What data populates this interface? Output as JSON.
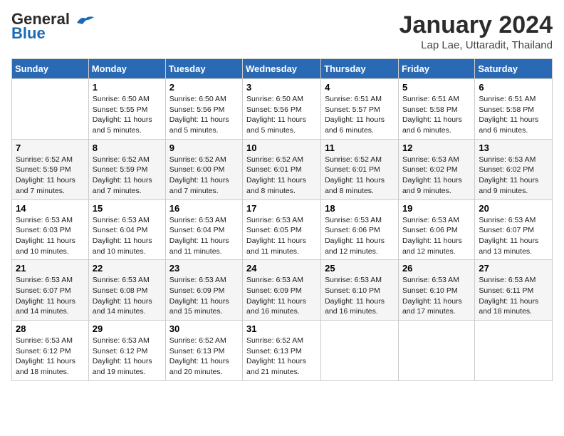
{
  "header": {
    "logo_line1": "General",
    "logo_line2": "Blue",
    "month": "January 2024",
    "location": "Lap Lae, Uttaradit, Thailand"
  },
  "days_of_week": [
    "Sunday",
    "Monday",
    "Tuesday",
    "Wednesday",
    "Thursday",
    "Friday",
    "Saturday"
  ],
  "weeks": [
    [
      {
        "day": "",
        "info": ""
      },
      {
        "day": "1",
        "info": "Sunrise: 6:50 AM\nSunset: 5:55 PM\nDaylight: 11 hours\nand 5 minutes."
      },
      {
        "day": "2",
        "info": "Sunrise: 6:50 AM\nSunset: 5:56 PM\nDaylight: 11 hours\nand 5 minutes."
      },
      {
        "day": "3",
        "info": "Sunrise: 6:50 AM\nSunset: 5:56 PM\nDaylight: 11 hours\nand 5 minutes."
      },
      {
        "day": "4",
        "info": "Sunrise: 6:51 AM\nSunset: 5:57 PM\nDaylight: 11 hours\nand 6 minutes."
      },
      {
        "day": "5",
        "info": "Sunrise: 6:51 AM\nSunset: 5:58 PM\nDaylight: 11 hours\nand 6 minutes."
      },
      {
        "day": "6",
        "info": "Sunrise: 6:51 AM\nSunset: 5:58 PM\nDaylight: 11 hours\nand 6 minutes."
      }
    ],
    [
      {
        "day": "7",
        "info": "Sunrise: 6:52 AM\nSunset: 5:59 PM\nDaylight: 11 hours\nand 7 minutes."
      },
      {
        "day": "8",
        "info": "Sunrise: 6:52 AM\nSunset: 5:59 PM\nDaylight: 11 hours\nand 7 minutes."
      },
      {
        "day": "9",
        "info": "Sunrise: 6:52 AM\nSunset: 6:00 PM\nDaylight: 11 hours\nand 7 minutes."
      },
      {
        "day": "10",
        "info": "Sunrise: 6:52 AM\nSunset: 6:01 PM\nDaylight: 11 hours\nand 8 minutes."
      },
      {
        "day": "11",
        "info": "Sunrise: 6:52 AM\nSunset: 6:01 PM\nDaylight: 11 hours\nand 8 minutes."
      },
      {
        "day": "12",
        "info": "Sunrise: 6:53 AM\nSunset: 6:02 PM\nDaylight: 11 hours\nand 9 minutes."
      },
      {
        "day": "13",
        "info": "Sunrise: 6:53 AM\nSunset: 6:02 PM\nDaylight: 11 hours\nand 9 minutes."
      }
    ],
    [
      {
        "day": "14",
        "info": "Sunrise: 6:53 AM\nSunset: 6:03 PM\nDaylight: 11 hours\nand 10 minutes."
      },
      {
        "day": "15",
        "info": "Sunrise: 6:53 AM\nSunset: 6:04 PM\nDaylight: 11 hours\nand 10 minutes."
      },
      {
        "day": "16",
        "info": "Sunrise: 6:53 AM\nSunset: 6:04 PM\nDaylight: 11 hours\nand 11 minutes."
      },
      {
        "day": "17",
        "info": "Sunrise: 6:53 AM\nSunset: 6:05 PM\nDaylight: 11 hours\nand 11 minutes."
      },
      {
        "day": "18",
        "info": "Sunrise: 6:53 AM\nSunset: 6:06 PM\nDaylight: 11 hours\nand 12 minutes."
      },
      {
        "day": "19",
        "info": "Sunrise: 6:53 AM\nSunset: 6:06 PM\nDaylight: 11 hours\nand 12 minutes."
      },
      {
        "day": "20",
        "info": "Sunrise: 6:53 AM\nSunset: 6:07 PM\nDaylight: 11 hours\nand 13 minutes."
      }
    ],
    [
      {
        "day": "21",
        "info": "Sunrise: 6:53 AM\nSunset: 6:07 PM\nDaylight: 11 hours\nand 14 minutes."
      },
      {
        "day": "22",
        "info": "Sunrise: 6:53 AM\nSunset: 6:08 PM\nDaylight: 11 hours\nand 14 minutes."
      },
      {
        "day": "23",
        "info": "Sunrise: 6:53 AM\nSunset: 6:09 PM\nDaylight: 11 hours\nand 15 minutes."
      },
      {
        "day": "24",
        "info": "Sunrise: 6:53 AM\nSunset: 6:09 PM\nDaylight: 11 hours\nand 16 minutes."
      },
      {
        "day": "25",
        "info": "Sunrise: 6:53 AM\nSunset: 6:10 PM\nDaylight: 11 hours\nand 16 minutes."
      },
      {
        "day": "26",
        "info": "Sunrise: 6:53 AM\nSunset: 6:10 PM\nDaylight: 11 hours\nand 17 minutes."
      },
      {
        "day": "27",
        "info": "Sunrise: 6:53 AM\nSunset: 6:11 PM\nDaylight: 11 hours\nand 18 minutes."
      }
    ],
    [
      {
        "day": "28",
        "info": "Sunrise: 6:53 AM\nSunset: 6:12 PM\nDaylight: 11 hours\nand 18 minutes."
      },
      {
        "day": "29",
        "info": "Sunrise: 6:53 AM\nSunset: 6:12 PM\nDaylight: 11 hours\nand 19 minutes."
      },
      {
        "day": "30",
        "info": "Sunrise: 6:52 AM\nSunset: 6:13 PM\nDaylight: 11 hours\nand 20 minutes."
      },
      {
        "day": "31",
        "info": "Sunrise: 6:52 AM\nSunset: 6:13 PM\nDaylight: 11 hours\nand 21 minutes."
      },
      {
        "day": "",
        "info": ""
      },
      {
        "day": "",
        "info": ""
      },
      {
        "day": "",
        "info": ""
      }
    ]
  ]
}
